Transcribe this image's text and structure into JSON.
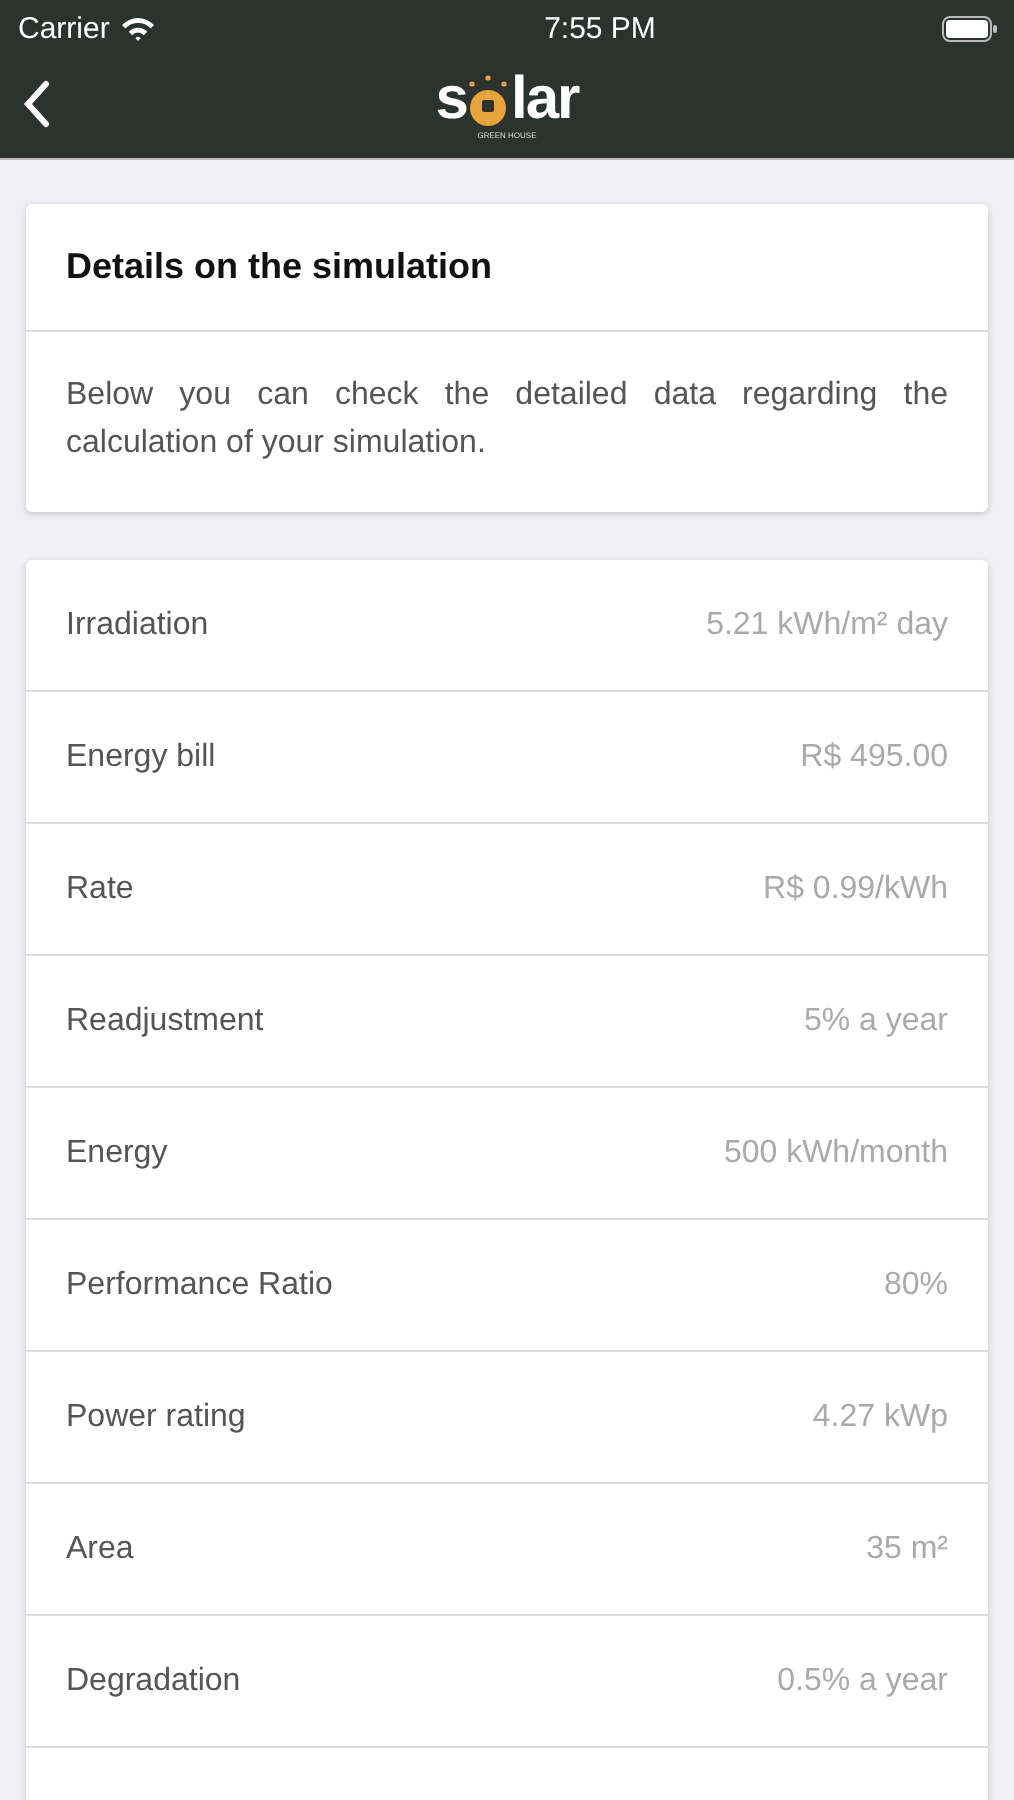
{
  "status_bar": {
    "carrier": "Carrier",
    "time": "7:55 PM"
  },
  "nav": {
    "logo": {
      "before": "s",
      "after": "lar",
      "subtitle": "GREEN HOUSE"
    }
  },
  "intro": {
    "title": "Details on the simulation",
    "description": "Below you can check the detailed data regarding the calculation of your simulation."
  },
  "details": [
    {
      "label": "Irradiation",
      "value": "5.21 kWh/m² day"
    },
    {
      "label": "Energy bill",
      "value": "R$ 495.00"
    },
    {
      "label": "Rate",
      "value": "R$ 0.99/kWh"
    },
    {
      "label": "Readjustment",
      "value": "5% a year"
    },
    {
      "label": "Energy",
      "value": "500 kWh/month"
    },
    {
      "label": "Performance Ratio",
      "value": "80%"
    },
    {
      "label": "Power rating",
      "value": "4.27 kWp"
    },
    {
      "label": "Area",
      "value": "35 m²"
    },
    {
      "label": "Degradation",
      "value": "0.5% a year"
    }
  ]
}
